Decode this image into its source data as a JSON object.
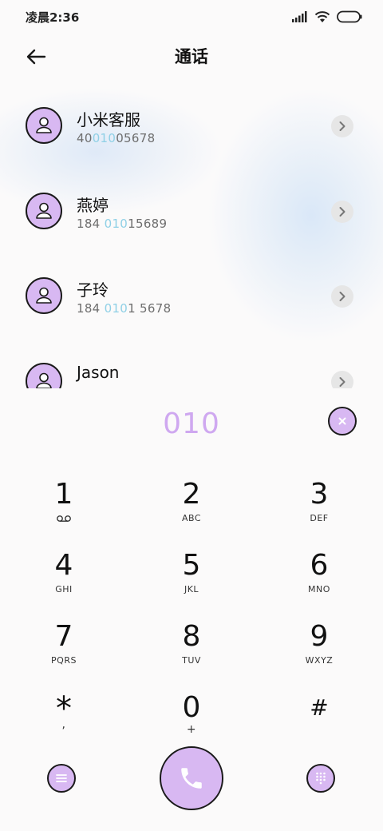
{
  "status_bar": {
    "time": "凌晨2:36",
    "icons": [
      "signal-icon",
      "wifi-icon",
      "battery-icon"
    ]
  },
  "header": {
    "title": "通话",
    "back_icon": "arrow-left-icon"
  },
  "contacts": [
    {
      "name": "小米客服",
      "number_pre": "40",
      "number_hl": "010",
      "number_post": "05678"
    },
    {
      "name": "燕婷",
      "number_pre": "184 ",
      "number_hl": "010",
      "number_post": "15689"
    },
    {
      "name": "子玲",
      "number_pre": "184 ",
      "number_hl": "010",
      "number_post": "1 5678"
    },
    {
      "name": "Jason",
      "number_pre": "",
      "number_hl": "",
      "number_post": ""
    }
  ],
  "dialer": {
    "number": "010"
  },
  "keypad": [
    {
      "digit": "1",
      "letters": ""
    },
    {
      "digit": "2",
      "letters": "ABC"
    },
    {
      "digit": "3",
      "letters": "DEF"
    },
    {
      "digit": "4",
      "letters": "GHI"
    },
    {
      "digit": "5",
      "letters": "JKL"
    },
    {
      "digit": "6",
      "letters": "MNO"
    },
    {
      "digit": "7",
      "letters": "PQRS"
    },
    {
      "digit": "8",
      "letters": "TUV"
    },
    {
      "digit": "9",
      "letters": "WXYZ"
    },
    {
      "digit": "*",
      "letters": ","
    },
    {
      "digit": "0",
      "letters": "+"
    },
    {
      "digit": "#",
      "letters": ""
    }
  ],
  "colors": {
    "accent": "#d8b8f2",
    "dial_text": "#cfa8f0",
    "highlight": "#8fd0e6",
    "background": "#fbfafa"
  }
}
